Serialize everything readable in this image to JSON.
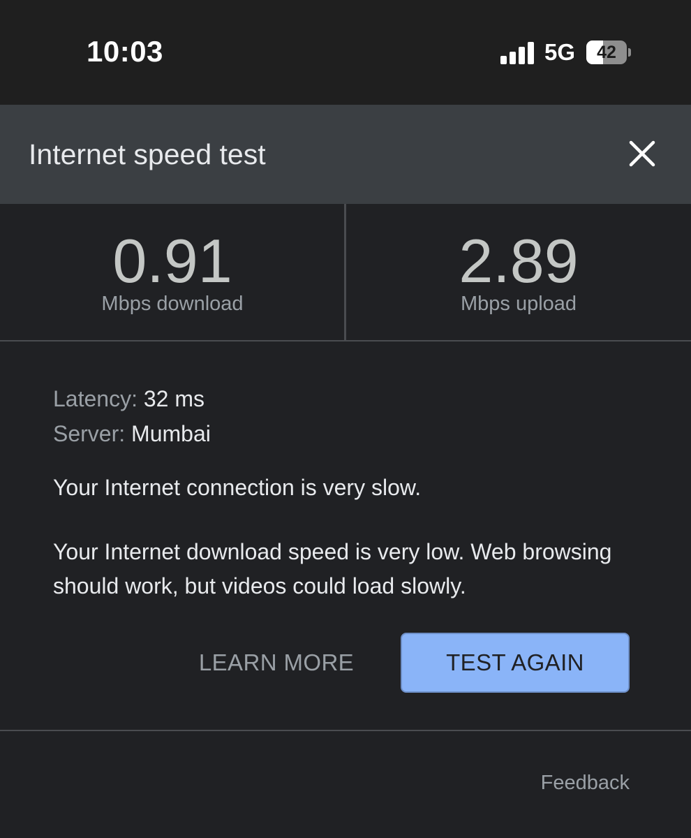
{
  "status_bar": {
    "time": "10:03",
    "network": "5G",
    "battery": "42",
    "battery_level": 0.42,
    "signal_bars": 4,
    "icons": [
      "signal-icon",
      "battery-icon"
    ]
  },
  "header": {
    "title": "Internet speed test",
    "close_icon": "close-icon"
  },
  "results": {
    "download": {
      "value": "0.91",
      "label": "Mbps download"
    },
    "upload": {
      "value": "2.89",
      "label": "Mbps upload"
    }
  },
  "details": {
    "latency_key": "Latency:",
    "latency_value": "32 ms",
    "server_key": "Server:",
    "server_value": "Mumbai"
  },
  "summary": "Your Internet connection is very slow.",
  "description": "Your Internet download speed is very low. Web browsing should work, but videos could load slowly.",
  "actions": {
    "learn_more": "LEARN MORE",
    "test_again": "TEST AGAIN"
  },
  "footer": {
    "feedback": "Feedback"
  },
  "colors": {
    "background": "#202124",
    "header": "#3b3f43",
    "accent": "#8ab4f8"
  }
}
